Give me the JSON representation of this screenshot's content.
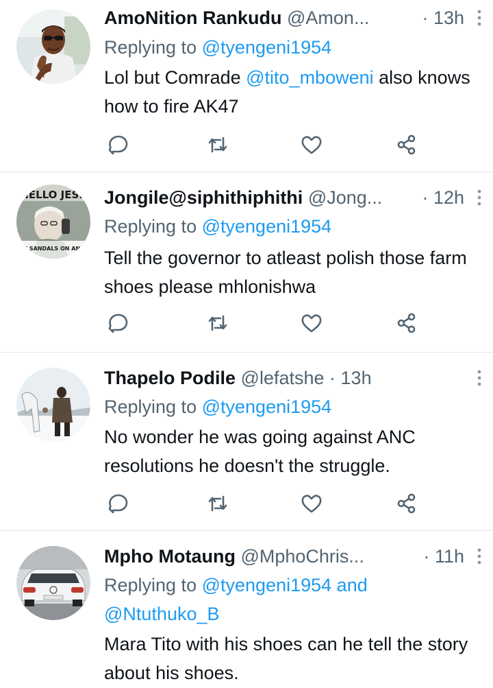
{
  "tweets": [
    {
      "name": "AmoNition Rankudu",
      "handle": "@Amon...",
      "time": "· 13h",
      "replying_prefix": "Replying to",
      "replying_to": "@tyengeni1954",
      "body_before": "Lol but Comrade ",
      "body_mention": "@tito_mboweni",
      "body_after": " also knows how to fire AK47"
    },
    {
      "name": "Jongile@siphithiphithi",
      "handle": "@Jong...",
      "time": "· 12h",
      "replying_prefix": "Replying to",
      "replying_to": "@tyengeni1954",
      "body": "Tell the governor to atleast polish those farm shoes please mhlonishwa",
      "avatar_text_top": "HELLO JES..",
      "avatar_text_bottom": "WITH SANDALS ON AND GO"
    },
    {
      "name": "Thapelo Podile",
      "handle": "@lefatshe",
      "time": "· 13h",
      "replying_prefix": "Replying to",
      "replying_to": "@tyengeni1954",
      "body": "No wonder he was going against ANC resolutions he doesn't the struggle."
    },
    {
      "name": "Mpho Motaung",
      "handle": "@MphoChris...",
      "time": "· 11h",
      "replying_prefix": "Replying to",
      "replying_to": "@tyengeni1954",
      "replying_and": " and",
      "replying_to_2": "@Ntuthuko_B",
      "body": "Mara Tito with his shoes can he tell the story about his shoes."
    }
  ],
  "action_icons": [
    "reply-icon",
    "retweet-icon",
    "like-icon",
    "share-icon"
  ],
  "colors": {
    "text": "#0f1419",
    "secondary": "#536471",
    "link": "#1d9bf0",
    "divider": "#e1e6ea"
  }
}
